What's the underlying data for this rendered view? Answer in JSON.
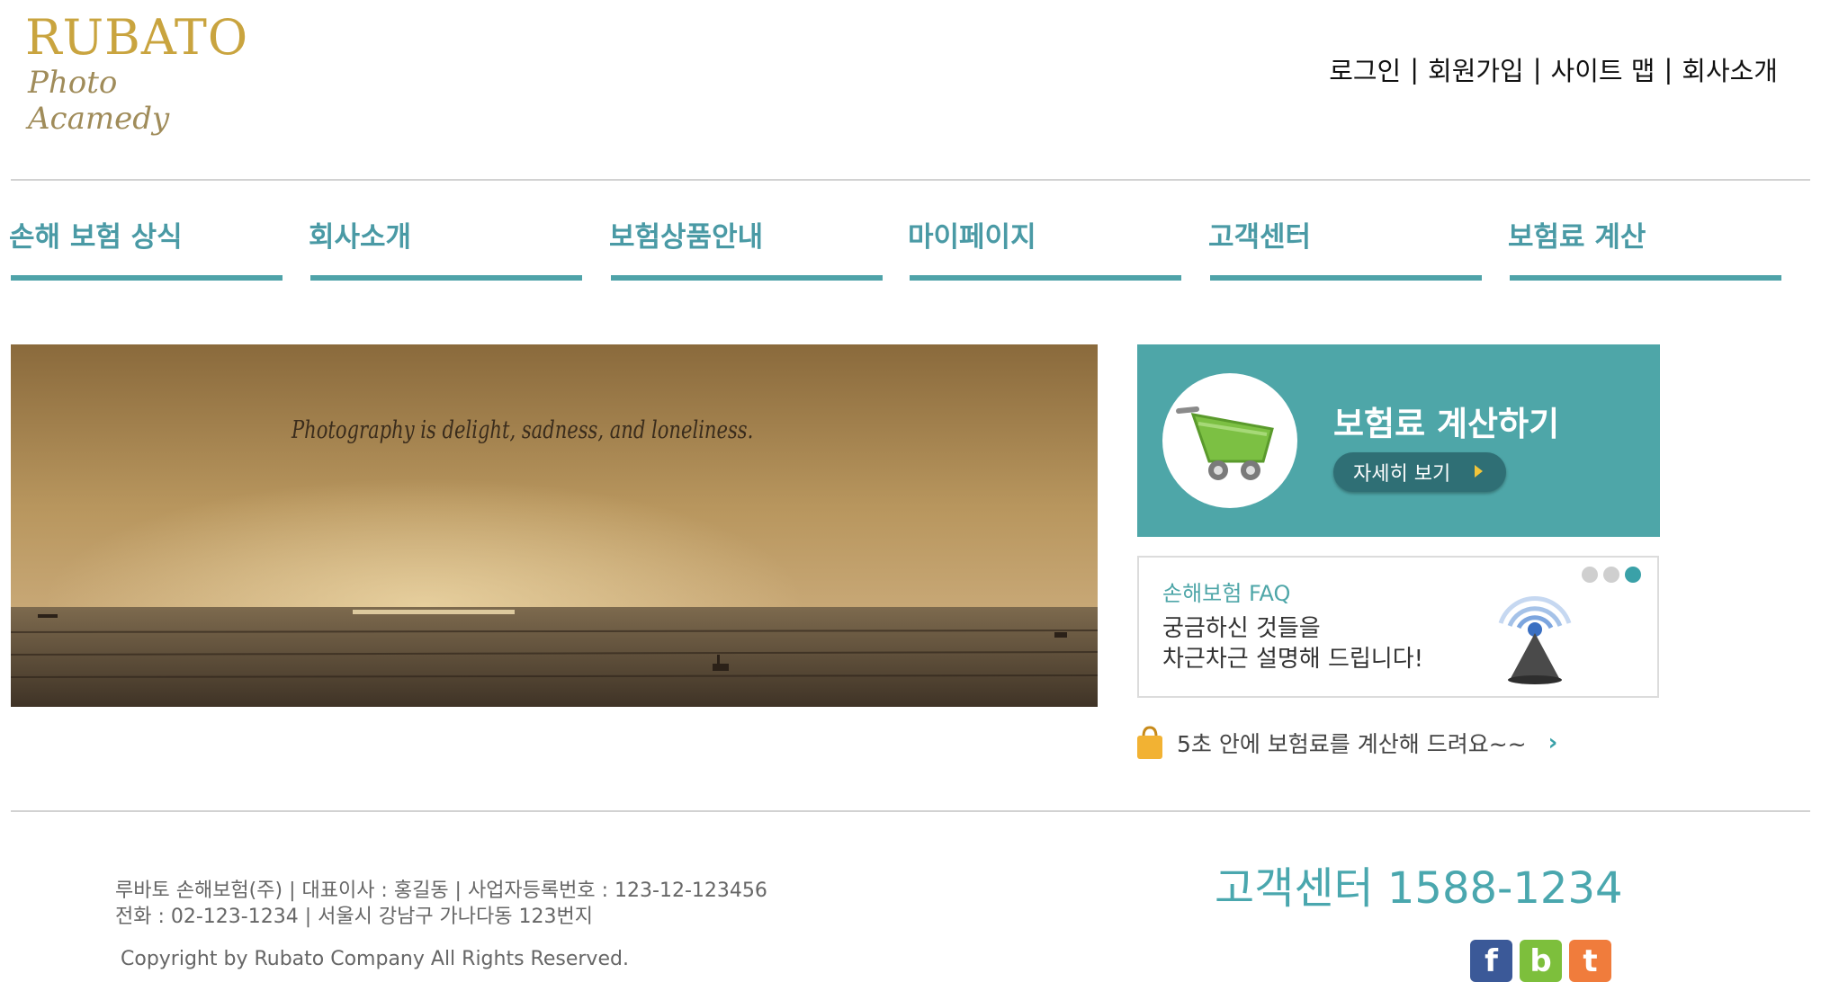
{
  "logo": {
    "main": "RUBATO",
    "sub": "Photo Acamedy"
  },
  "topnav": {
    "items": [
      "로그인",
      "회원가입",
      "사이트 맵",
      "회사소개"
    ],
    "separator": "|"
  },
  "gnb": {
    "items": [
      "손해 보험 상식",
      "회사소개",
      "보험상품안내",
      "마이페이지",
      "고객센터",
      "보험료 계산"
    ]
  },
  "hero": {
    "quote": "Photography is delight, sadness, and loneliness."
  },
  "calc": {
    "title": "보험료 계산하기",
    "button": "자세히 보기"
  },
  "faq": {
    "title": "손해보험 FAQ",
    "line1": "궁금하신 것들을",
    "line2": "차근차근 설명해 드립니다!"
  },
  "promo": {
    "text": "5초 안에 보험료를 계산해 드려요~~",
    "chevron": "›"
  },
  "footer": {
    "line1": "루바토 손해보험(주) | 대표이사 : 홍길동 | 사업자등록번호 : 123-12-123456",
    "line2": "전화 : 02-123-1234 | 서울시 강남구 가나다동 123번지",
    "copyright": "Copyright by Rubato Company All Rights Reserved.",
    "cs": "고객센터 1588-1234"
  },
  "social": {
    "items": [
      {
        "letter": "f",
        "color": "#3b5998"
      },
      {
        "letter": "b",
        "color": "#7dbf3c"
      },
      {
        "letter": "t",
        "color": "#f07c3c"
      }
    ]
  },
  "colors": {
    "accent": "#4ea6a8",
    "gold": "#c9a43f"
  }
}
